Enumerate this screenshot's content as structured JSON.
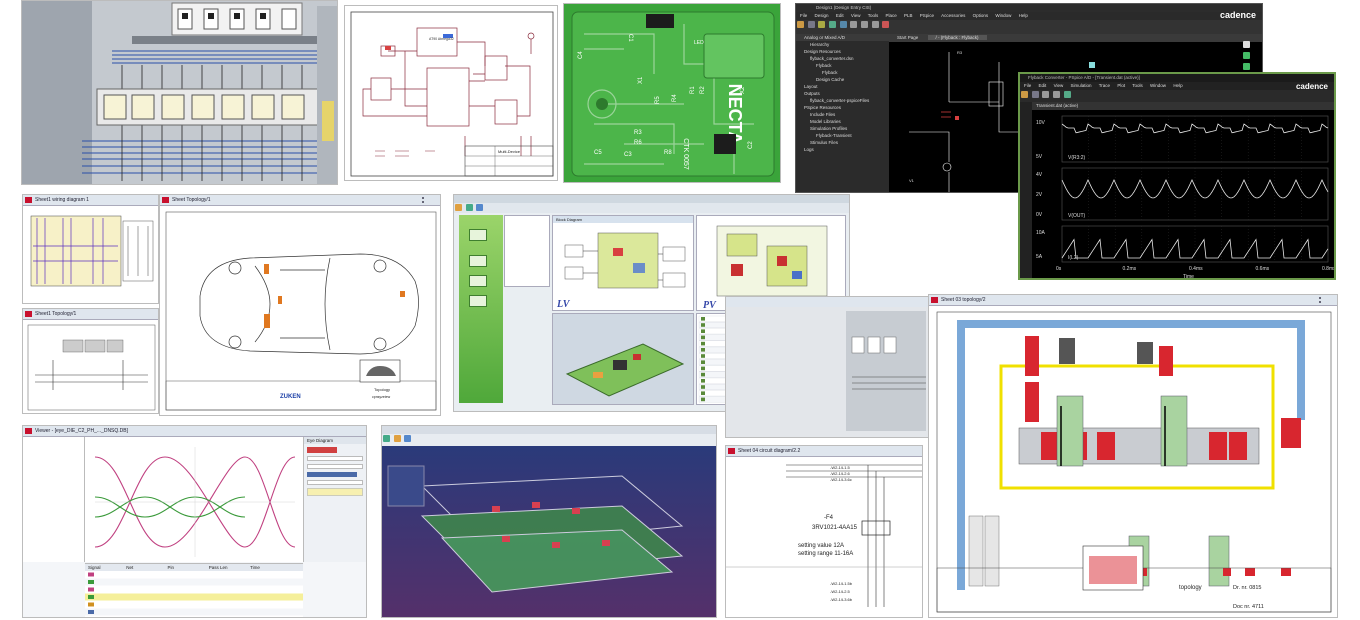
{
  "tiles": {
    "panel3d": {},
    "schematic": {
      "ic_label": "AT90 Atmega32",
      "title_block": "Multi-Device"
    },
    "pcb": {
      "brand": "NECTA",
      "code": "CTK 0057",
      "refs": [
        "C4",
        "C1",
        "R3",
        "R6",
        "R8",
        "R5",
        "R4",
        "X1",
        "R1",
        "R2",
        "C3",
        "X2",
        "C2",
        "C5",
        "LED"
      ]
    },
    "cadence": {
      "title": "Design1 (Design Entry CIS)",
      "menu": [
        "File",
        "Design",
        "Edit",
        "View",
        "Tools",
        "Place",
        "PLB",
        "PSpice",
        "Accessories",
        "Options",
        "Window",
        "Help"
      ],
      "brand": "cadence",
      "tree_header": "Analog or Mixed A/D",
      "tree": [
        "Hierarchy",
        "Design Resources",
        "flyback_converter.dsn",
        "Flyback",
        "Flyback",
        "Design Cache",
        "Layout",
        "Outputs",
        "flyback_converter-pspiceFiles",
        "PSpice Resources",
        "Include Files",
        "Model Libraries",
        "Simulation Profiles",
        "Flyback-Transient",
        "Stimulus Files",
        "Logs"
      ],
      "tab1": "Start Page",
      "tab2": "/ - (Flyback : Flyback)"
    },
    "probe": {
      "title": "Flyback Converter - PSpice A/D - [Transient.dat (active)]",
      "menu": [
        "File",
        "Edit",
        "View",
        "Simulation",
        "Trace",
        "Plot",
        "Tools",
        "Window",
        "Help"
      ],
      "brand": "cadence",
      "tab": "Transient.dat (active)",
      "traces": [
        "V(R3:2)",
        "V(OUT)",
        "I(L2)"
      ],
      "x_ticks": [
        "0s",
        "0.2ms",
        "0.4ms",
        "0.6ms",
        "0.8ms"
      ],
      "xlabel": "Time",
      "y1": [
        "10V",
        "5V"
      ],
      "y2": [
        "4V",
        "2V",
        "0V"
      ],
      "y3": [
        "10A",
        "5A"
      ]
    },
    "wiring": {
      "title1": "Sheet1 wiring diagram 1",
      "title2": "Sheet1 Topology/1"
    },
    "carTopology": {
      "title": "Sheet Topology/1",
      "logo": "ZUKEN",
      "caption": "Topology",
      "caption2": "cpnsyzeiew"
    },
    "lvpv": {
      "label_lv": "LV",
      "label_pv": "PV",
      "tab": "Block Diagram"
    },
    "eye": {
      "title": "Viewer - [eye_DIE_C2_PH_..._DNSQ.DB]",
      "side_title": "Eye Diagram",
      "legend": [
        "Signal",
        "Net",
        "Pin",
        "Pass Len",
        "Time"
      ]
    },
    "pcb3d": {},
    "circuit": {
      "title": "Sheet 04 circuit diagram/2.2",
      "device": "-F4",
      "part": "3RV1021-4AA15",
      "setting1": "setting value 12A",
      "setting2": "setting range 11-16A",
      "wires": [
        "-W2-1/L1.5",
        "-W2-1/L2.6",
        "-W2-1/L3.6c",
        "-W2-1/L1.5b",
        "-W2-1/L2.5",
        "-W2-1/L3.6b"
      ]
    },
    "topology2": {
      "title": "Sheet 03 topology/2",
      "caption": "topology",
      "drawing_no": "Dr. nr. 0815",
      "doc_no": "Doc nr. 4711"
    }
  },
  "colors": {
    "cadence_bg": "#000000",
    "probe_grid": "#2a2a2a",
    "pcb_green": "#3aa43a",
    "highlight_yellow": "#f2e600",
    "device_red": "#d8262f",
    "rail_blue": "#6a9fd0"
  }
}
